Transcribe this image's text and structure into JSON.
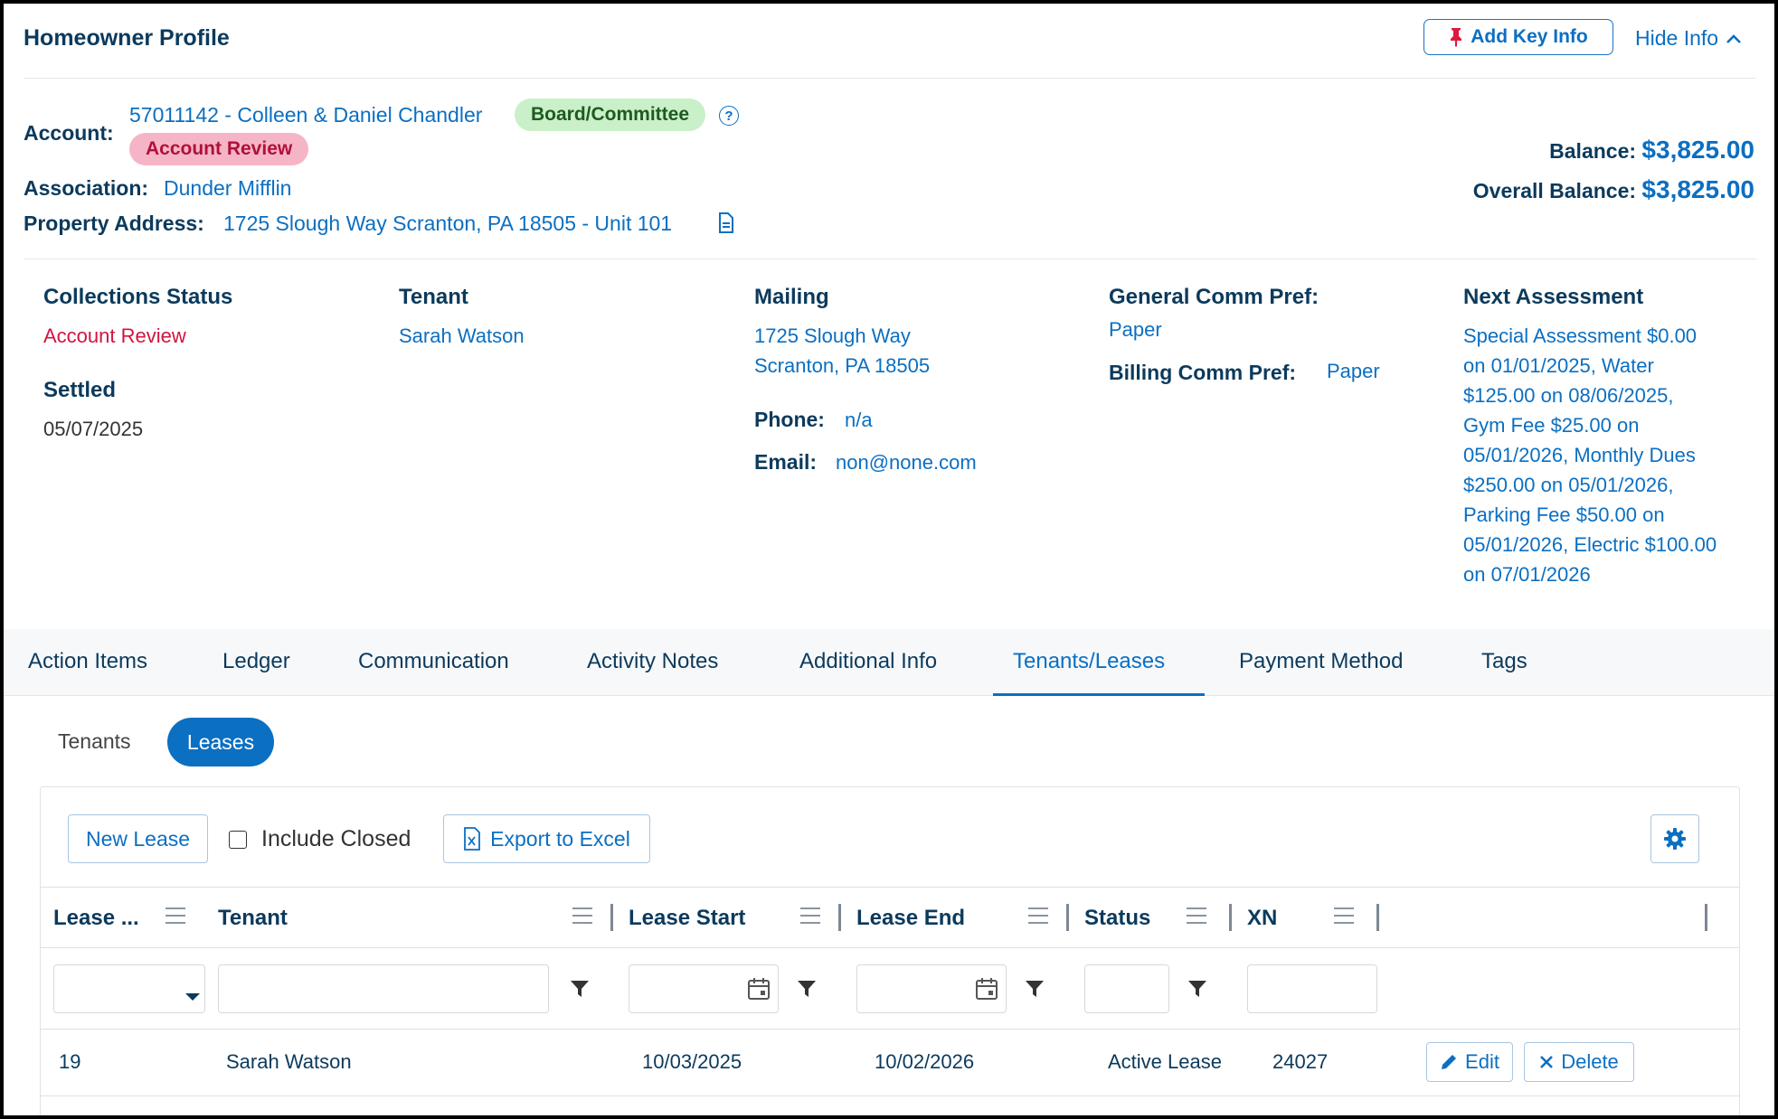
{
  "header": {
    "title": "Homeowner Profile",
    "add_key_info": "Add Key Info",
    "hide_info": "Hide Info"
  },
  "account": {
    "label": "Account:",
    "value": "57011142 - Colleen & Daniel Chandler",
    "badge_board": "Board/Committee",
    "help": "?",
    "badge_review": "Account Review",
    "association_label": "Association:",
    "association_value": "Dunder Mifflin",
    "property_label": "Property Address:",
    "property_value": "1725 Slough Way Scranton, PA 18505 - Unit 101"
  },
  "balance": {
    "balance_label": "Balance:",
    "balance_value": "$3,825.00",
    "overall_label": "Overall Balance:",
    "overall_value": "$3,825.00"
  },
  "info": {
    "collections_h": "Collections Status",
    "collections_v": "Account Review",
    "settled_h": "Settled",
    "settled_v": "05/07/2025",
    "tenant_h": "Tenant",
    "tenant_v": "Sarah Watson",
    "mailing_h": "Mailing",
    "mailing_line1": "1725 Slough Way",
    "mailing_line2": "Scranton, PA 18505",
    "phone_label": "Phone:",
    "phone_value": "n/a",
    "email_label": "Email:",
    "email_value": "non@none.com",
    "gen_comm_h": "General Comm Pref:",
    "gen_comm_v": "Paper",
    "bill_comm_label": "Billing Comm Pref:",
    "bill_comm_v": "Paper",
    "next_assess_h": "Next Assessment",
    "next_assess_lines": [
      "Special Assessment $0.00",
      "on 01/01/2025, Water",
      "$125.00 on 08/06/2025,",
      "Gym Fee $25.00 on",
      "05/01/2026, Monthly Dues",
      "$250.00 on 05/01/2026,",
      "Parking Fee $50.00 on",
      "05/01/2026, Electric $100.00",
      "on 07/01/2026"
    ]
  },
  "tabs": [
    "Action Items",
    "Ledger",
    "Communication",
    "Activity Notes",
    "Additional Info",
    "Tenants/Leases",
    "Payment Method",
    "Tags"
  ],
  "subtabs": {
    "tenants": "Tenants",
    "leases": "Leases"
  },
  "toolbar": {
    "new_lease": "New Lease",
    "include_closed": "Include Closed",
    "export": "Export to Excel"
  },
  "grid": {
    "columns": [
      "Lease ...",
      "Tenant",
      "Lease Start",
      "Lease End",
      "Status",
      "XN"
    ],
    "rows": [
      {
        "lease": "19",
        "tenant": "Sarah Watson",
        "start": "10/03/2025",
        "end": "10/02/2026",
        "status": "Active Lease",
        "xn": "24027"
      }
    ],
    "edit": "Edit",
    "delete": "Delete"
  },
  "colors": {
    "accent": "#0b6fc2",
    "heading": "#0b3a5c",
    "alert": "#d1143f"
  }
}
